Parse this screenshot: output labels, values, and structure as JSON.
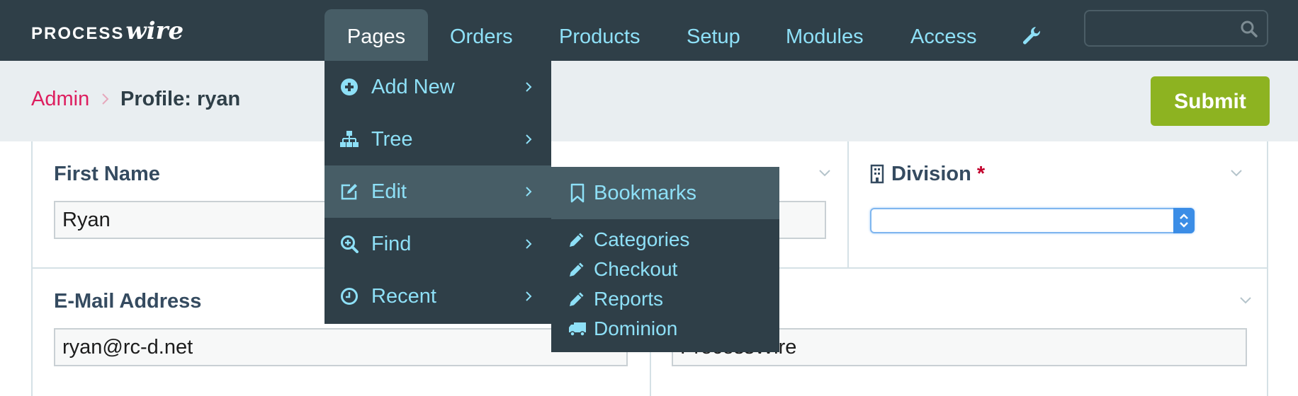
{
  "logo": {
    "prefix": "PROCESS",
    "suffix": "wire"
  },
  "nav": {
    "items": [
      {
        "label": "Pages"
      },
      {
        "label": "Orders"
      },
      {
        "label": "Products"
      },
      {
        "label": "Setup"
      },
      {
        "label": "Modules"
      },
      {
        "label": "Access"
      }
    ],
    "active": "Pages",
    "extra_icon": "wrench-icon",
    "search": {
      "value": "",
      "icon": "search-icon"
    }
  },
  "header": {
    "breadcrumb": "Admin",
    "title": "Profile: ryan",
    "submit_label": "Submit"
  },
  "form": {
    "first_name": {
      "label": "First Name",
      "value": "Ryan"
    },
    "division": {
      "label": "Division",
      "required_mark": "*",
      "value": ""
    },
    "email": {
      "label": "E-Mail Address",
      "value": "ryan@rc-d.net"
    },
    "company": {
      "value": "ProcessWire"
    }
  },
  "menu": {
    "items": [
      {
        "label": "Add New",
        "icon": "plus-circle-icon"
      },
      {
        "label": "Tree",
        "icon": "sitemap-icon"
      },
      {
        "label": "Edit",
        "icon": "edit-icon"
      },
      {
        "label": "Find",
        "icon": "search-plus-icon"
      },
      {
        "label": "Recent",
        "icon": "clock-icon"
      }
    ],
    "highlighted": "Edit"
  },
  "submenu": {
    "bookmarks": {
      "label": "Bookmarks",
      "icon": "bookmark-icon"
    },
    "items": [
      {
        "label": "Categories",
        "icon": "pencil-icon"
      },
      {
        "label": "Checkout",
        "icon": "pencil-icon"
      },
      {
        "label": "Reports",
        "icon": "pencil-icon"
      },
      {
        "label": "Dominion",
        "icon": "truck-icon"
      }
    ]
  },
  "colors": {
    "topbar": "#2f3f48",
    "menu_highlight": "#475d66",
    "link": "#8ee0f7",
    "breadcrumb": "#dd1e5f",
    "submit": "#8db321",
    "header_band": "#e9eef1"
  }
}
